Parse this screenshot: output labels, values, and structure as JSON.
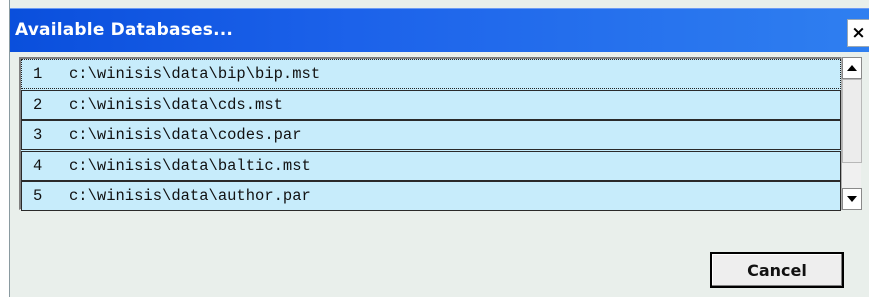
{
  "window": {
    "title": "Available Databases...",
    "close_label": "×"
  },
  "list": {
    "items": [
      {
        "num": "1",
        "path": "c:\\winisis\\data\\bip\\bip.mst",
        "selected": true
      },
      {
        "num": "2",
        "path": "c:\\winisis\\data\\cds.mst"
      },
      {
        "num": "3",
        "path": "c:\\winisis\\data\\codes.par"
      },
      {
        "num": "4",
        "path": "c:\\winisis\\data\\baltic.mst"
      },
      {
        "num": "5",
        "path": "c:\\winisis\\data\\author.par"
      }
    ]
  },
  "buttons": {
    "cancel_label": "Cancel"
  },
  "colors": {
    "titlebar": "#1c62ea",
    "list_background": "#c7ecfb",
    "dialog_background": "#e9efeb"
  },
  "icons": {
    "close": "close-icon",
    "scroll_up": "scroll-up-arrow-icon",
    "scroll_down": "scroll-down-arrow-icon"
  }
}
